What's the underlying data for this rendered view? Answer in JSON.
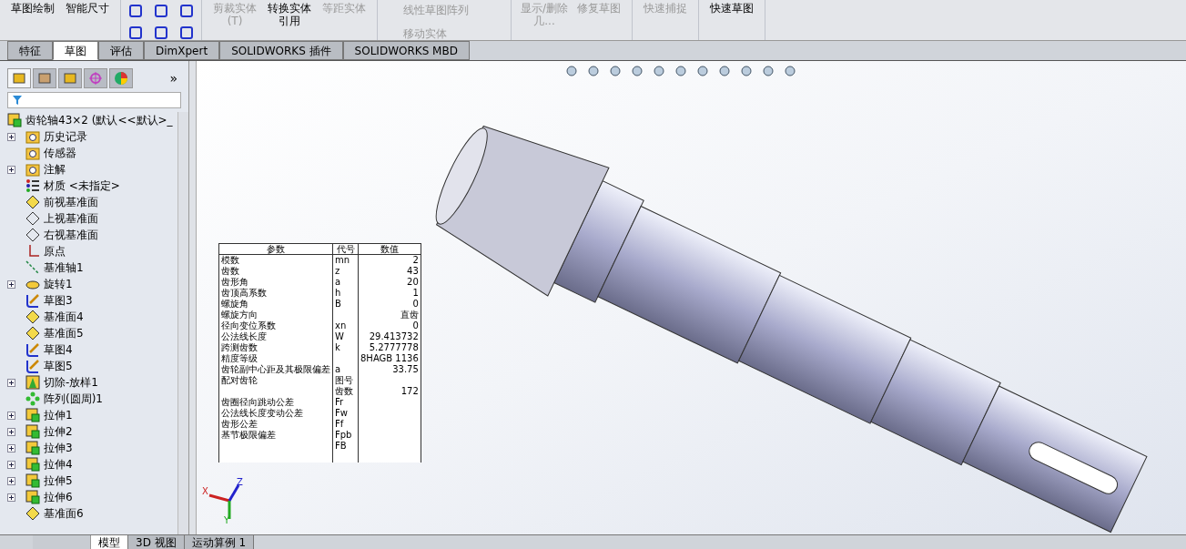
{
  "ribbon": {
    "groups": [
      {
        "kind": "big",
        "items": [
          {
            "label": "草图绘制",
            "disabled": false
          },
          {
            "label": "智能尺寸",
            "disabled": false
          }
        ]
      },
      {
        "kind": "small"
      },
      {
        "kind": "big",
        "items": [
          {
            "label": "剪裁实体(T)",
            "disabled": true
          },
          {
            "label": "转换实体引用",
            "disabled": false
          },
          {
            "label": "等距实体",
            "disabled": true
          }
        ]
      },
      {
        "kind": "list",
        "items": [
          {
            "label": "线性草图阵列",
            "disabled": true
          },
          {
            "label": "移动实体",
            "disabled": true
          }
        ]
      },
      {
        "kind": "big",
        "items": [
          {
            "label": "显示/删除几...",
            "disabled": true
          },
          {
            "label": "修复草图",
            "disabled": true
          }
        ]
      },
      {
        "kind": "big",
        "items": [
          {
            "label": "快速捕捉",
            "disabled": true
          }
        ]
      },
      {
        "kind": "big",
        "items": [
          {
            "label": "快速草图",
            "disabled": false
          }
        ]
      }
    ]
  },
  "tabs": [
    {
      "label": "特征",
      "selected": false
    },
    {
      "label": "草图",
      "selected": true
    },
    {
      "label": "评估",
      "selected": false
    },
    {
      "label": "DimXpert",
      "selected": false
    },
    {
      "label": "SOLIDWORKS 插件",
      "selected": false
    },
    {
      "label": "SOLIDWORKS MBD",
      "selected": false
    }
  ],
  "panel_tabs": [
    {
      "kind": "tree",
      "selected": true
    },
    {
      "kind": "property",
      "selected": false
    },
    {
      "kind": "config",
      "selected": false
    },
    {
      "kind": "target",
      "selected": false
    },
    {
      "kind": "appearance",
      "selected": false
    }
  ],
  "panel_more": "»",
  "tree": {
    "root": "齿轮轴43×2  (默认<<默认>_",
    "items": [
      {
        "label": "历史记录",
        "kind": "history",
        "collapsed": true
      },
      {
        "label": "传感器",
        "kind": "sensor",
        "collapsed": false
      },
      {
        "label": "注解",
        "kind": "annotation",
        "collapsed": true
      },
      {
        "label": "材质 <未指定>",
        "kind": "material",
        "collapsed": false
      },
      {
        "label": "前视基准面",
        "kind": "plane-hl",
        "collapsed": false
      },
      {
        "label": "上视基准面",
        "kind": "plane",
        "collapsed": false
      },
      {
        "label": "右视基准面",
        "kind": "plane",
        "collapsed": false
      },
      {
        "label": "原点",
        "kind": "origin",
        "collapsed": false
      },
      {
        "label": "基准轴1",
        "kind": "axis",
        "collapsed": false
      },
      {
        "label": "旋转1",
        "kind": "revolve",
        "collapsed": true
      },
      {
        "label": "草图3",
        "kind": "sketch",
        "collapsed": false
      },
      {
        "label": "基准面4",
        "kind": "plane-hl",
        "collapsed": false
      },
      {
        "label": "基准面5",
        "kind": "plane-hl",
        "collapsed": false
      },
      {
        "label": "草图4",
        "kind": "sketch",
        "collapsed": false
      },
      {
        "label": "草图5",
        "kind": "sketch",
        "collapsed": false
      },
      {
        "label": "切除-放样1",
        "kind": "cut",
        "collapsed": true
      },
      {
        "label": "阵列(圆周)1",
        "kind": "pattern",
        "collapsed": false
      },
      {
        "label": "拉伸1",
        "kind": "extrude",
        "collapsed": true
      },
      {
        "label": "拉伸2",
        "kind": "extrude",
        "collapsed": true
      },
      {
        "label": "拉伸3",
        "kind": "extrude",
        "collapsed": true
      },
      {
        "label": "拉伸4",
        "kind": "extrude",
        "collapsed": true
      },
      {
        "label": "拉伸5",
        "kind": "extrude",
        "collapsed": true
      },
      {
        "label": "拉伸6",
        "kind": "extrude",
        "collapsed": true
      },
      {
        "label": "基准面6",
        "kind": "plane-hl",
        "collapsed": false
      }
    ]
  },
  "table": {
    "columns": [
      "参数",
      "代号",
      "数值"
    ],
    "rows": [
      [
        "模数",
        "mn",
        "2"
      ],
      [
        "齿数",
        "z",
        "43"
      ],
      [
        "齿形角",
        "a",
        "20"
      ],
      [
        "齿顶高系数",
        "h",
        "1"
      ],
      [
        "螺旋角",
        "B",
        "0"
      ],
      [
        "螺旋方向",
        "",
        "直齿"
      ],
      [
        "径向变位系数",
        "xn",
        "0"
      ],
      [
        "公法线长度",
        "W",
        "29.413732"
      ],
      [
        "跨测齿数",
        "k",
        "5.2777778"
      ],
      [
        "精度等级",
        "",
        "8HAGB 1136"
      ],
      [
        "齿轮副中心距及其极限偏差",
        "a",
        "33.75"
      ],
      [
        "配对齿轮",
        "图号",
        ""
      ],
      [
        "",
        "齿数",
        "172"
      ],
      [
        "齿圈径向跳动公差",
        "Fr",
        ""
      ],
      [
        "公法线长度变动公差",
        "Fw",
        ""
      ],
      [
        "齿形公差",
        "Ff",
        ""
      ],
      [
        "基节极限偏差",
        "Fpb",
        ""
      ],
      [
        "",
        "FB",
        ""
      ],
      [
        "",
        "",
        ""
      ]
    ]
  },
  "triad": {
    "x": "X",
    "y": "Y",
    "z": "Z"
  },
  "bottom_tabs": [
    {
      "label": "模型",
      "selected": true
    },
    {
      "label": "3D 视图",
      "selected": false
    },
    {
      "label": "运动算例 1",
      "selected": false
    }
  ]
}
